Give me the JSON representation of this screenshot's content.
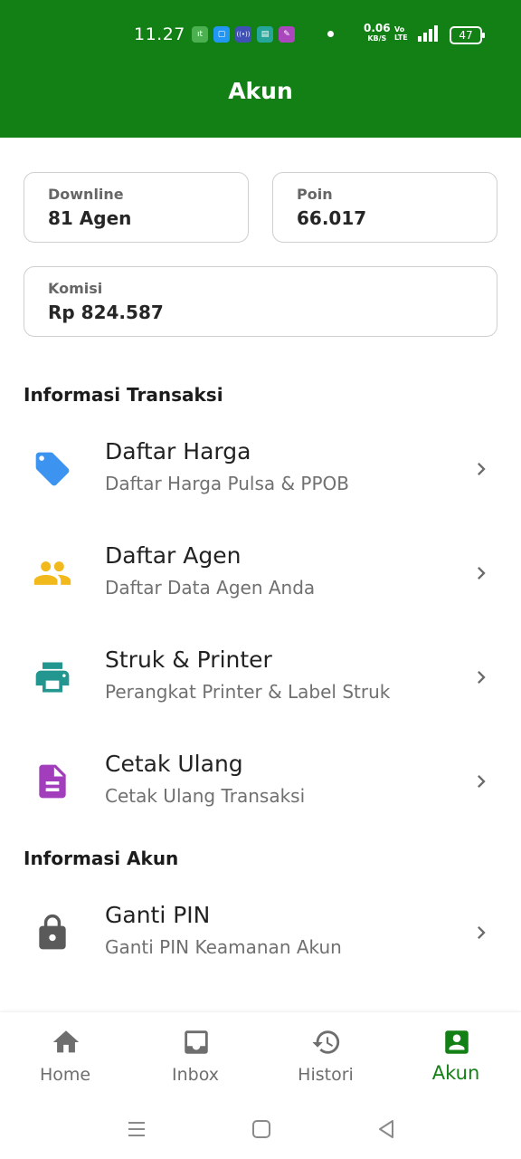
{
  "status_bar": {
    "time": "11.27",
    "apps": [
      {
        "icon": "app-icon-green",
        "color": "#4caf50",
        "glyph": "ıt"
      },
      {
        "icon": "app-icon-blue",
        "color": "#2196f3",
        "glyph": "▢"
      },
      {
        "icon": "app-icon-radio",
        "color": "#3f51b5",
        "glyph": "((•))"
      },
      {
        "icon": "app-icon-chat",
        "color": "#26a69a",
        "glyph": "▤"
      },
      {
        "icon": "app-icon-pin",
        "color": "#ab47bc",
        "glyph": "✎"
      }
    ],
    "net_speed": "0.06",
    "net_unit": "KB/S",
    "volte_top": "Vo",
    "volte_bottom": "LTE",
    "network": "4G",
    "battery": "47"
  },
  "header": {
    "title": "Akun"
  },
  "summary": {
    "downline": {
      "label": "Downline",
      "value": "81 Agen"
    },
    "poin": {
      "label": "Poin",
      "value": "66.017"
    },
    "komisi": {
      "label": "Komisi",
      "value": "Rp 824.587"
    }
  },
  "sections": {
    "transaksi": "Informasi Transaksi",
    "akun": "Informasi Akun"
  },
  "menu": [
    {
      "title": "Daftar Harga",
      "subtitle": "Daftar Harga Pulsa & PPOB",
      "icon": "price-tag-icon",
      "color": "#3d94f0"
    },
    {
      "title": "Daftar Agen",
      "subtitle": "Daftar Data Agen Anda",
      "icon": "people-icon",
      "color": "#f2b91d"
    },
    {
      "title": "Struk & Printer",
      "subtitle": "Perangkat Printer & Label Struk",
      "icon": "printer-icon",
      "color": "#22968f"
    },
    {
      "title": "Cetak Ulang",
      "subtitle": "Cetak Ulang Transaksi",
      "icon": "document-icon",
      "color": "#a23dbc"
    },
    {
      "title": "Ganti PIN",
      "subtitle": "Ganti PIN Keamanan Akun",
      "icon": "lock-icon",
      "color": "#5a5a5a"
    }
  ],
  "bottom_nav": [
    {
      "label": "Home",
      "icon": "home-icon",
      "active": false
    },
    {
      "label": "Inbox",
      "icon": "inbox-icon",
      "active": false
    },
    {
      "label": "Histori",
      "icon": "history-icon",
      "active": false
    },
    {
      "label": "Akun",
      "icon": "account-icon",
      "active": true
    }
  ],
  "colors": {
    "primary": "#138016",
    "inactive": "#6e6e6e",
    "chevron": "#6b6b6b"
  }
}
